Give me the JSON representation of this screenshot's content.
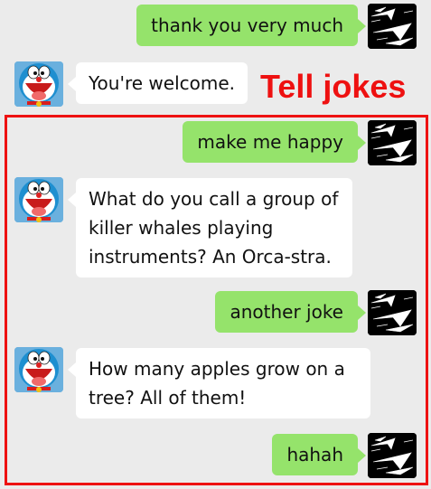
{
  "annotation": {
    "label": "Tell jokes",
    "color": "#ee1111"
  },
  "colors": {
    "background": "#ebebeb",
    "user_bubble": "#95e36b",
    "bot_bubble": "#ffffff"
  },
  "icons": {
    "user_avatar": "paper-airplane-icon",
    "bot_avatar": "doraemon-icon"
  },
  "messages": [
    {
      "sender": "user",
      "text": "thank you very much"
    },
    {
      "sender": "bot",
      "text": "You're welcome."
    },
    {
      "sender": "user",
      "text": "make me happy"
    },
    {
      "sender": "bot",
      "text": "What do you call a group of killer whales playing instruments? An Orca-stra."
    },
    {
      "sender": "user",
      "text": "another joke"
    },
    {
      "sender": "bot",
      "text": "How many apples grow on a tree? All of them!"
    },
    {
      "sender": "user",
      "text": "hahah"
    }
  ]
}
